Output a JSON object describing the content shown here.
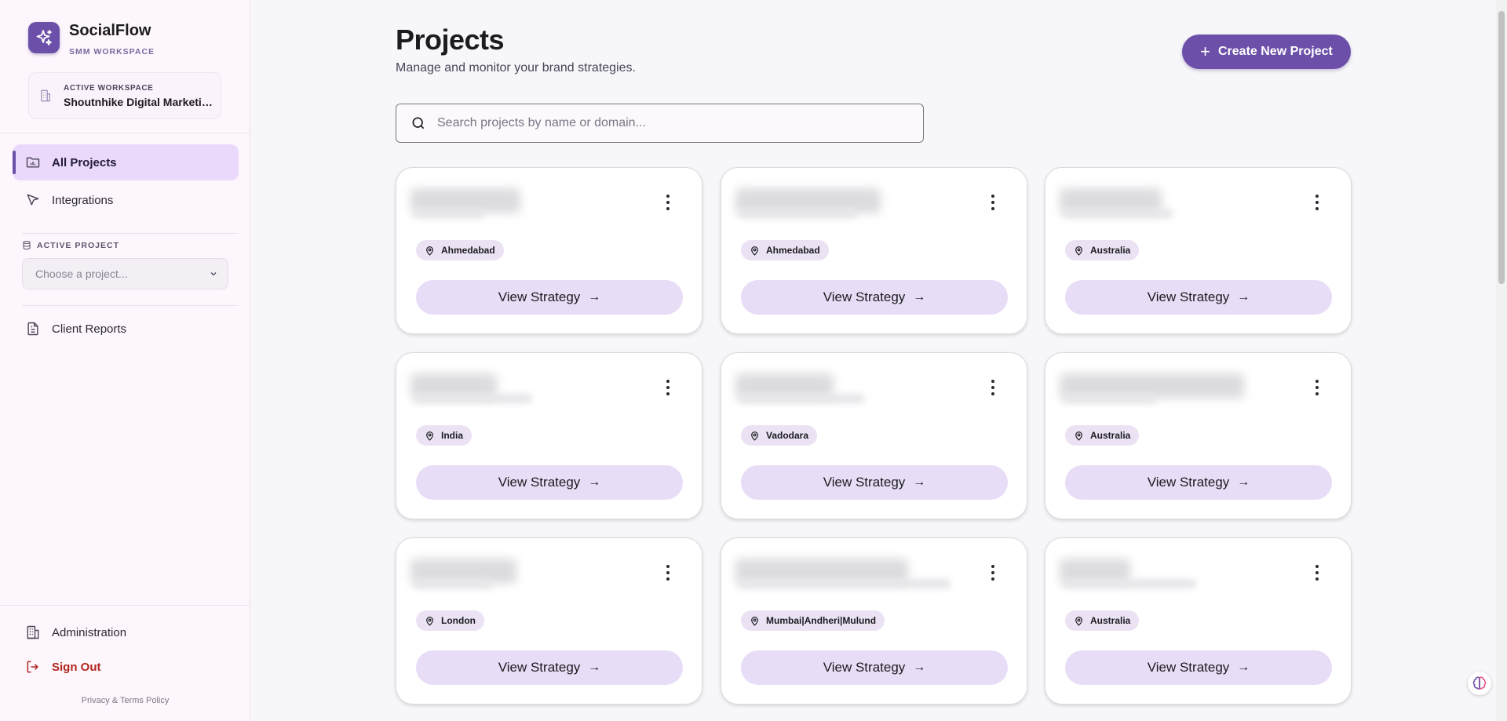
{
  "brand": {
    "name": "SocialFlow",
    "subtitle": "SMM WORKSPACE"
  },
  "workspace": {
    "label": "ACTIVE WORKSPACE",
    "name": "Shoutnhike Digital Marketing..."
  },
  "nav": {
    "all_projects": "All Projects",
    "integrations": "Integrations",
    "client_reports": "Client Reports",
    "administration": "Administration",
    "sign_out": "Sign Out"
  },
  "active_project": {
    "label": "ACTIVE PROJECT",
    "placeholder": "Choose a project..."
  },
  "footer": {
    "privacy": "Privacy & Terms Policy"
  },
  "header": {
    "title": "Projects",
    "subtitle": "Manage and monitor your brand strategies.",
    "create_button": "Create New Project"
  },
  "search": {
    "placeholder": "Search projects by name or domain..."
  },
  "projects": [
    {
      "location": "Ahmedabad",
      "action": "View Strategy"
    },
    {
      "location": "Ahmedabad",
      "action": "View Strategy"
    },
    {
      "location": "Australia",
      "action": "View Strategy"
    },
    {
      "location": "India",
      "action": "View Strategy"
    },
    {
      "location": "Vadodara",
      "action": "View Strategy"
    },
    {
      "location": "Australia",
      "action": "View Strategy"
    },
    {
      "location": "London",
      "action": "View Strategy"
    },
    {
      "location": "Mumbai|Andheri|Mulund",
      "action": "View Strategy"
    },
    {
      "location": "Australia",
      "action": "View Strategy"
    }
  ],
  "colors": {
    "primary": "#6b4fa8",
    "chip": "#ebe3f4",
    "action": "#e8ddf6",
    "active_nav": "#ead9fa",
    "danger": "#b3261e"
  },
  "icons": {
    "brand": "sparkle-icon",
    "workspace": "building-icon",
    "all_projects": "folder-chart-icon",
    "integrations": "cursor-icon",
    "active_project": "database-icon",
    "client_reports": "document-icon",
    "administration": "office-icon",
    "sign_out": "logout-icon",
    "search": "search-icon",
    "menu": "more-vertical-icon",
    "location": "location-pin-icon",
    "arrow": "arrow-right-icon",
    "plus": "plus-icon"
  }
}
